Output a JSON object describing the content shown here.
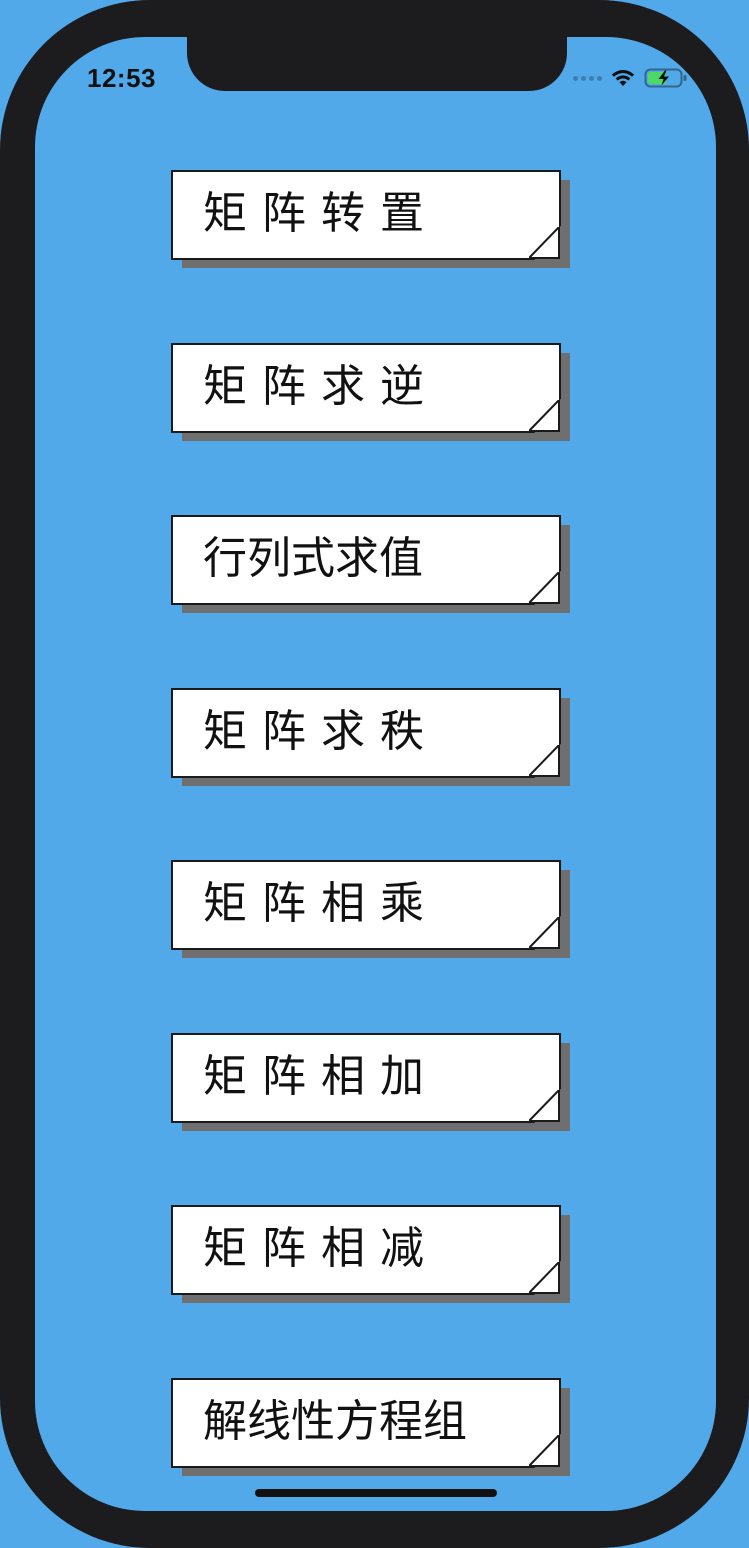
{
  "status_bar": {
    "time": "12:53",
    "icons": [
      "cellular-dots-icon",
      "wifi-icon",
      "battery-charging-icon"
    ]
  },
  "colors": {
    "background": "#52a9ea",
    "card": "#ffffff",
    "card_shadow": "#6f6f6f",
    "bezel": "#1c1c1e",
    "battery": "#4cd964"
  },
  "menu": {
    "items": [
      {
        "label": "矩阵转置"
      },
      {
        "label": "矩阵求逆"
      },
      {
        "label": "行列式求值"
      },
      {
        "label": "矩阵求秩"
      },
      {
        "label": "矩阵相乘"
      },
      {
        "label": "矩阵相加"
      },
      {
        "label": "矩阵相减"
      },
      {
        "label": "解线性方程组"
      }
    ]
  }
}
